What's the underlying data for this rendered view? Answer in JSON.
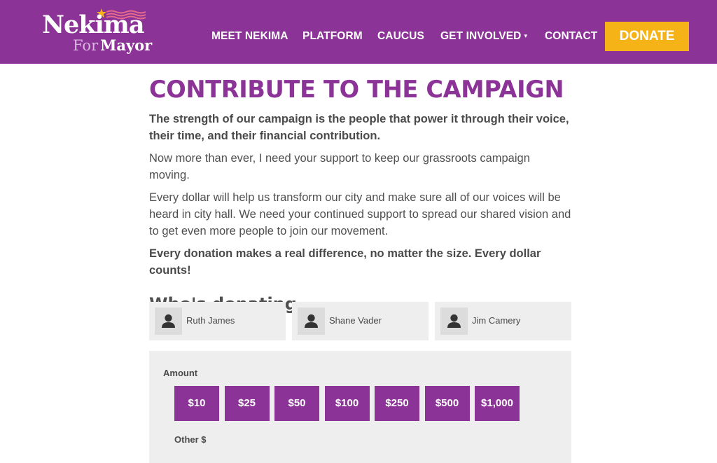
{
  "brand": {
    "name": "Nekima",
    "for": "For",
    "mayor": "Mayor",
    "accent": "#8b3396",
    "donate_color": "#f6b317"
  },
  "nav": {
    "items": [
      "MEET NEKIMA",
      "PLATFORM",
      "CAUCUS",
      "GET INVOLVED",
      "CONTACT"
    ],
    "dropdown_caret": "▾",
    "donate": "DONATE"
  },
  "main": {
    "title": "CONTRIBUTE TO THE CAMPAIGN",
    "intro": "The strength of our campaign is the people that power it through their voice, their time, and their financial contribution.",
    "p2": "Now more than ever, I need your support to keep our grassroots campaign moving.",
    "p3": "Every dollar will help us transform our city and make sure all of our voices will be heard in city hall. We need your continued support to spread our shared vision and to get even more people to join our movement.",
    "p4": "Every donation makes a real difference, no matter the size. Every dollar counts!",
    "donating_heading": "Who's donating"
  },
  "donors": [
    "Ruth James",
    "Shane Vader",
    "Jim Camery"
  ],
  "form": {
    "amount_label": "Amount",
    "amounts": [
      "$10",
      "$25",
      "$50",
      "$100",
      "$250",
      "$500",
      "$1,000"
    ],
    "other_label": "Other $"
  }
}
